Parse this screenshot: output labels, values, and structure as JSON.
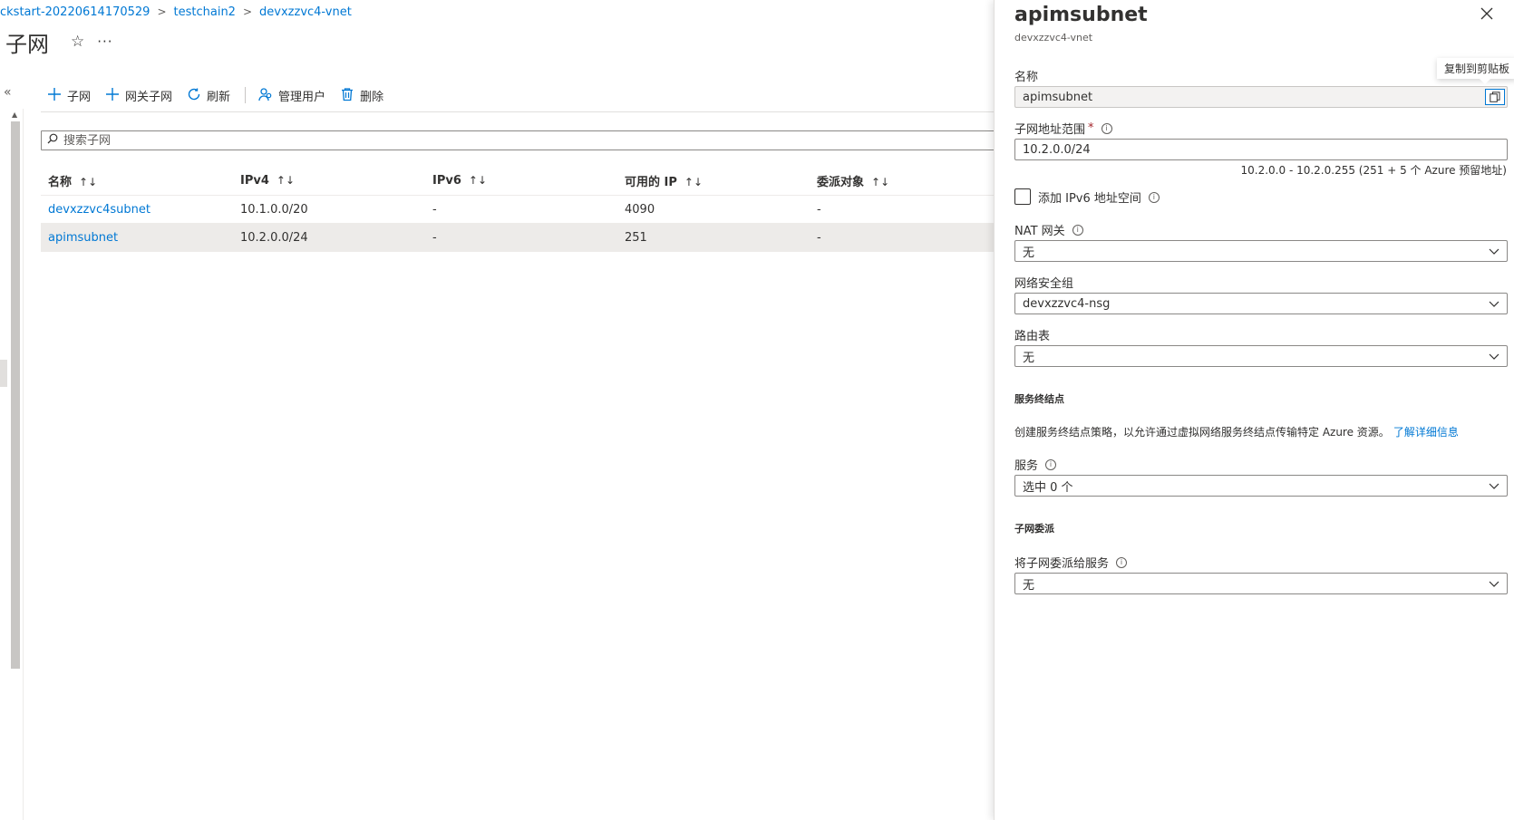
{
  "breadcrumb": {
    "items": [
      "ckstart-20220614170529",
      "testchain2",
      "devxzzvc4-vnet"
    ],
    "separator": ">"
  },
  "page": {
    "title": "子网",
    "favorite_glyph": "☆",
    "more_glyph": "···",
    "collapse_glyph": "«"
  },
  "toolbar": {
    "add_subnet": "子网",
    "add_gateway_subnet": "网关子网",
    "refresh": "刷新",
    "manage_users": "管理用户",
    "delete": "删除"
  },
  "search": {
    "placeholder": "搜索子网",
    "value": ""
  },
  "grid": {
    "columns": [
      "名称",
      "IPv4",
      "IPv6",
      "可用的 IP",
      "委派对象"
    ],
    "sort_glyph": "↑↓",
    "rows": [
      {
        "name": "devxzzvc4subnet",
        "ipv4": "10.1.0.0/20",
        "ipv6": "-",
        "available_ips": "4090",
        "delegated_to": "-"
      },
      {
        "name": "apimsubnet",
        "ipv4": "10.2.0.0/24",
        "ipv6": "-",
        "available_ips": "251",
        "delegated_to": "-"
      }
    ],
    "selected_row": 1
  },
  "panel": {
    "title": "apimsubnet",
    "subtitle": "devxzzvc4-vnet",
    "close_glyph": "✕",
    "name_label": "名称",
    "name_value": "apimsubnet",
    "copy_tooltip": "复制到剪贴板",
    "address_range_label": "子网地址范围",
    "required_mark": "*",
    "address_range_value": "10.2.0.0/24",
    "address_range_hint": "10.2.0.0 - 10.2.0.255 (251 + 5 个 Azure 预留地址)",
    "ipv6_checkbox_label": "添加 IPv6 地址空间",
    "ipv6_checked": false,
    "nat_label": "NAT 网关",
    "nat_value": "无",
    "nsg_label": "网络安全组",
    "nsg_value": "devxzzvc4-nsg",
    "route_label": "路由表",
    "route_value": "无",
    "service_endpoints_heading": "服务终结点",
    "service_endpoints_desc": "创建服务终结点策略，以允许通过虚拟网络服务终结点传输特定 Azure 资源。",
    "learn_more": "了解详细信息",
    "services_label": "服务",
    "services_value": "选中 0 个",
    "delegation_heading": "子网委派",
    "delegation_label": "将子网委派给服务",
    "delegation_value": "无"
  },
  "colors": {
    "accent": "#0078d4",
    "text": "#323130",
    "required": "#a4262c",
    "selected_row": "#edebe9"
  },
  "icons": {
    "add": "plus-icon",
    "refresh": "refresh-icon",
    "users": "users-icon",
    "delete": "trash-icon",
    "search": "search-icon",
    "info": "info-icon",
    "copy": "copy-icon",
    "chevron": "chevron-down-icon",
    "close": "close-icon"
  }
}
